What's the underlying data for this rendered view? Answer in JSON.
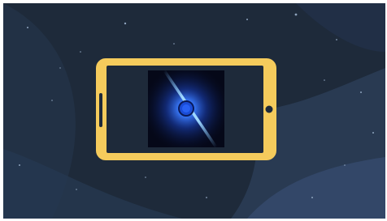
{
  "scene": {
    "background_color": "#1e2a3a",
    "wave_colors": [
      "#24344a",
      "#2c3f59",
      "#34496a"
    ],
    "star_color": "#8ea3bd"
  },
  "phone": {
    "frame_color": "#f5cb5c",
    "screen_color": "#1e2a3a"
  },
  "screen_image": {
    "description_icon": "blue-light-flare",
    "background": "#050818",
    "glow_color": "#3a7bff",
    "beam_color": "#7fc4ff",
    "core_color": "#1a4cd6"
  }
}
